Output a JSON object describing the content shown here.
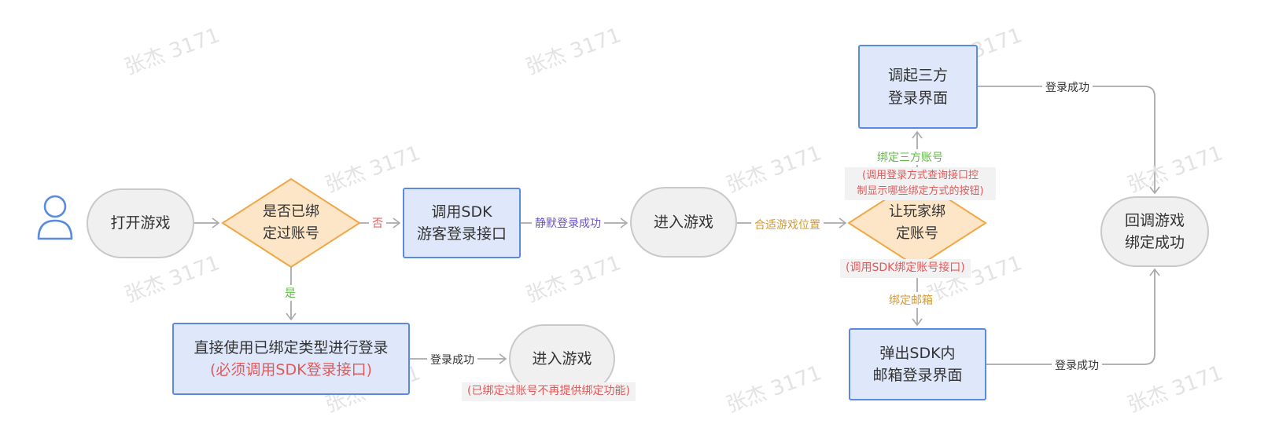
{
  "watermark": "张杰 3171",
  "colors": {
    "node_blue_fill": "#dfe8fb",
    "node_blue_border": "#5b8be0",
    "oval_fill": "#f0f0f1",
    "oval_border": "#c9c9cc",
    "diamond_fill": "#fde6c8",
    "diamond_border": "#f0a746",
    "edge": "#a9a9ad",
    "red_text": "#e05a5a",
    "purple_text": "#6a51c9",
    "orange_text": "#d79a2f",
    "green_text": "#64b84a"
  },
  "nodes": {
    "open_game": "打开游戏",
    "is_bound": {
      "line1": "是否已绑",
      "line2": "定过账号"
    },
    "sdk_guest": {
      "line1": "调用SDK",
      "line2": "游客登录接口"
    },
    "enter_game_1": "进入游戏",
    "let_bind": {
      "line1": "让玩家绑",
      "line2": "定账号"
    },
    "third_party": {
      "line1": "调起三方",
      "line2": "登录界面"
    },
    "email_login": {
      "line1": "弹出SDK内",
      "line2": "邮箱登录界面"
    },
    "callback": {
      "line1": "回调游戏",
      "line2": "绑定成功"
    },
    "direct_login": {
      "line1": "直接使用已绑定类型进行登录",
      "line2": "(必须调用SDK登录接口)"
    },
    "enter_game_2": "进入游戏"
  },
  "edge_labels": {
    "no": "否",
    "yes": "是",
    "silent_login": "静默登录成功",
    "proper_position": "合适游戏位置",
    "bind_third": "绑定三方账号",
    "bind_email": "绑定邮箱",
    "login_success_top": "登录成功",
    "login_success_bottom": "登录成功",
    "login_success_left": "登录成功"
  },
  "notes": {
    "query_interface": {
      "line1": "(调用登录方式查询接口控",
      "line2": "制显示哪些绑定方式的按钮)"
    },
    "bind_interface": "(调用SDK绑定账号接口)",
    "no_bind": "(已绑定过账号不再提供绑定功能)"
  },
  "icons": {
    "user": "user-icon"
  }
}
